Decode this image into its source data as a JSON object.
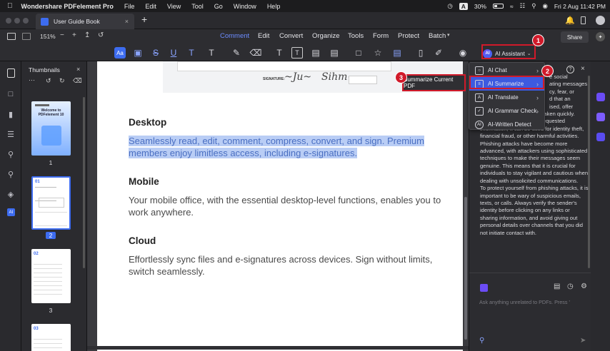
{
  "menubar": {
    "app_name": "Wondershare PDFelement Pro",
    "items": [
      "File",
      "Edit",
      "View",
      "Tool",
      "Go",
      "Window",
      "Help"
    ],
    "input_indicator": "A",
    "battery": "30%",
    "datetime": "Fri 2 Aug  11:42 PM"
  },
  "tabbar": {
    "doc_title": "User Guide Book",
    "new_tab": "+"
  },
  "toolbar": {
    "zoom": "151%",
    "tabs": [
      "Comment",
      "Edit",
      "Convert",
      "Organize",
      "Tools",
      "Form",
      "Protect",
      "Batch"
    ],
    "share_label": "Share",
    "ai_assistant_label": "AI Assistant",
    "ai_avatar": "AI"
  },
  "thumbnails": {
    "title": "Thumbnails",
    "page1_title": "Welcome to PDFelement 10",
    "page2_heading": "01",
    "page3_heading": "02",
    "page4_heading": "03",
    "numbers": [
      "1",
      "2",
      "3"
    ]
  },
  "document": {
    "signature_label": "SIGNATURE:",
    "sections": [
      {
        "heading": "Desktop",
        "body": "Seamlessly read, edit, comment, compress, convert, and sign. Premium members enjoy limitless access, including e-signatures."
      },
      {
        "heading": "Mobile",
        "body": "Your mobile office, with the essential desktop-level functions, enables you to work anywhere."
      },
      {
        "heading": "Cloud",
        "body": "Effortlessly sync files and e-signatures across devices. Sign without limits, switch seamlessly."
      }
    ]
  },
  "ai_menu": {
    "items": [
      {
        "label": "AI Chat",
        "has_submenu": true
      },
      {
        "label": "AI Summarize",
        "has_submenu": true
      },
      {
        "label": "AI Translate",
        "has_submenu": true
      },
      {
        "label": "AI Grammar Check",
        "has_submenu": true
      },
      {
        "label": "AI-Written Detect",
        "has_submenu": false
      }
    ],
    "submenu_item": "Summarize Current PDF"
  },
  "callouts": [
    "1",
    "2",
    "3"
  ],
  "chat": {
    "partial_lines": [
      "e social",
      "ating messages",
      "cy, fear, or",
      "d that an",
      "ised, offer",
      "t taken quickly."
    ],
    "text": "Once victims provide the requested information, it can be used for identity theft, financial fraud, or other harmful activities.\nPhishing attacks have become more advanced, with attackers using sophisticated techniques to make their messages seem genuine. This means that it is crucial for individuals to stay vigilant and cautious when dealing with unsolicited communications.\nTo protect yourself from phishing attacks, it is important to be wary of suspicious emails, texts, or calls. Always verify the sender's identity before clicking on any links or sharing information, and avoid giving out personal details over channels that you did not initiate contact with.",
    "input_placeholder": "Ask anything unrelated to PDFs. Press '",
    "send_icon": "send-icon"
  },
  "colors": {
    "accent": "#3d5ae0",
    "callout": "#d11a2a",
    "highlight": "#b9cdf5"
  }
}
